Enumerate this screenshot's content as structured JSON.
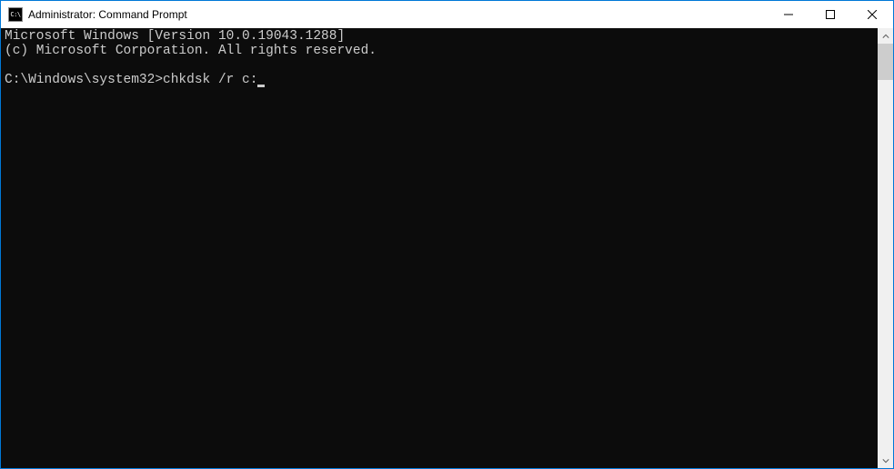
{
  "titlebar": {
    "icon_text": "C:\\",
    "title": "Administrator: Command Prompt"
  },
  "console": {
    "line1": "Microsoft Windows [Version 10.0.19043.1288]",
    "line2": "(c) Microsoft Corporation. All rights reserved.",
    "blank": "",
    "prompt": "C:\\Windows\\system32>",
    "command": "chkdsk /r c:"
  }
}
